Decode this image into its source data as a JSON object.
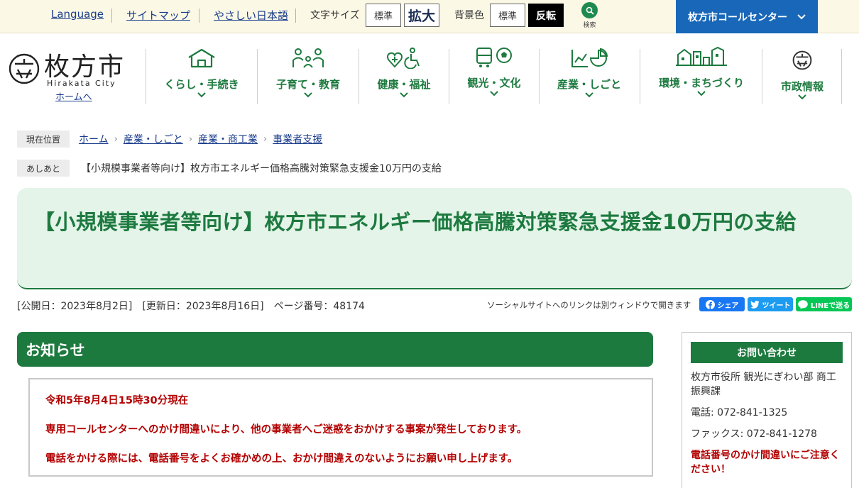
{
  "topbar": {
    "language": "Language",
    "sitemap": "サイトマップ",
    "easy_japanese": "やさしい日本語",
    "font_size_label": "文字サイズ",
    "font_standard": "標準",
    "font_large": "拡大",
    "bg_label": "背景色",
    "bg_standard": "標準",
    "bg_invert": "反転",
    "search_label": "検索",
    "call_center": "枚方市コールセンター"
  },
  "logo": {
    "name": "枚方市",
    "roman": "Hirakata City",
    "home": "ホームへ"
  },
  "nav": [
    {
      "label": "くらし・手続き",
      "icon": "house-icon"
    },
    {
      "label": "子育て・教育",
      "icon": "family-icon"
    },
    {
      "label": "健康・福祉",
      "icon": "health-wheelchair-icon"
    },
    {
      "label": "観光・文化",
      "icon": "bus-ball-icon"
    },
    {
      "label": "産業・しごと",
      "icon": "chart-icon"
    },
    {
      "label": "環境・まちづくり",
      "icon": "city-icon"
    },
    {
      "label": "市政情報",
      "icon": "city-emblem-icon"
    }
  ],
  "breadcrumb": {
    "label": "現在位置",
    "items": [
      "ホーム",
      "産業・しごと",
      "産業・商工業",
      "事業者支援"
    ]
  },
  "footprint": {
    "label": "あしあと",
    "text": "【小規模事業者等向け】枚方市エネルギー価格高騰対策緊急支援金10万円の支給"
  },
  "title": "【小規模事業者等向け】枚方市エネルギー価格高騰対策緊急支援金10万円の支給",
  "meta": {
    "published": "[公開日：2023年8月2日]",
    "updated": "[更新日：2023年8月16日]",
    "page_number": "ページ番号：48174"
  },
  "social": {
    "note": "ソーシャルサイトへのリンクは別ウィンドウで開きます",
    "facebook": "シェア",
    "twitter": "ツイート",
    "line": "LINEで送る",
    "colors": {
      "facebook": "#1877f2",
      "twitter": "#1d9bf0",
      "line": "#06c755"
    }
  },
  "notice": {
    "heading": "お知らせ",
    "lines": [
      "令和5年8月4日15時30分現在",
      "専用コールセンターへのかけ間違いにより、他の事業者へご迷惑をおかけする事案が発生しております。",
      "電話をかける際には、電話番号をよくお確かめの上、おかけ間違えのないようにお願い申し上げます。"
    ]
  },
  "contact": {
    "heading": "お問い合わせ",
    "department": "枚方市役所 観光にぎわい部 商工振興課",
    "phone": "電話: 072-841-1325",
    "fax": "ファックス: 072-841-1278",
    "warning": "電話番号のかけ間違いにご注意ください！"
  },
  "colors": {
    "brand_green": "#1d7a3f",
    "title_bg": "#e4f4e9",
    "call_blue": "#1867b8",
    "alert_red": "#b30000",
    "topbar_bg": "#fbf8e6"
  }
}
